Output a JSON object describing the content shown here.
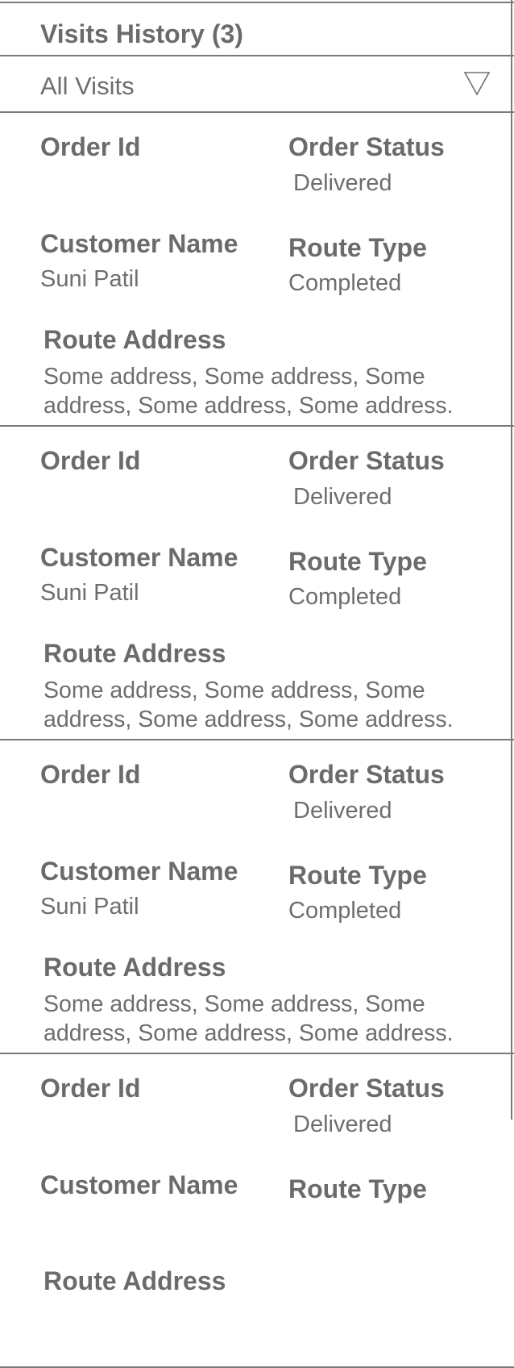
{
  "header": {
    "title": "Visits History (3)"
  },
  "filter": {
    "selected": "All Visits",
    "icon": "triangle-down-outline"
  },
  "labels": {
    "order_id": "Order Id",
    "order_status": "Order Status",
    "customer_name": "Customer Name",
    "route_type": "Route Type",
    "route_address": "Route Address"
  },
  "visits": [
    {
      "order_id": "",
      "order_status": "Delivered",
      "customer_name": "Suni Patil",
      "route_type": "Completed",
      "route_address": "Some address, Some address, Some address, Some address, Some address."
    },
    {
      "order_id": "",
      "order_status": "Delivered",
      "customer_name": "Suni Patil",
      "route_type": "Completed",
      "route_address": "Some address, Some address, Some address, Some address, Some address."
    },
    {
      "order_id": "",
      "order_status": "Delivered",
      "customer_name": "Suni Patil",
      "route_type": "Completed",
      "route_address": "Some address, Some address, Some address, Some address, Some address."
    },
    {
      "order_id": "",
      "order_status": "Delivered",
      "customer_name": "",
      "route_type": "",
      "route_address": ""
    }
  ]
}
